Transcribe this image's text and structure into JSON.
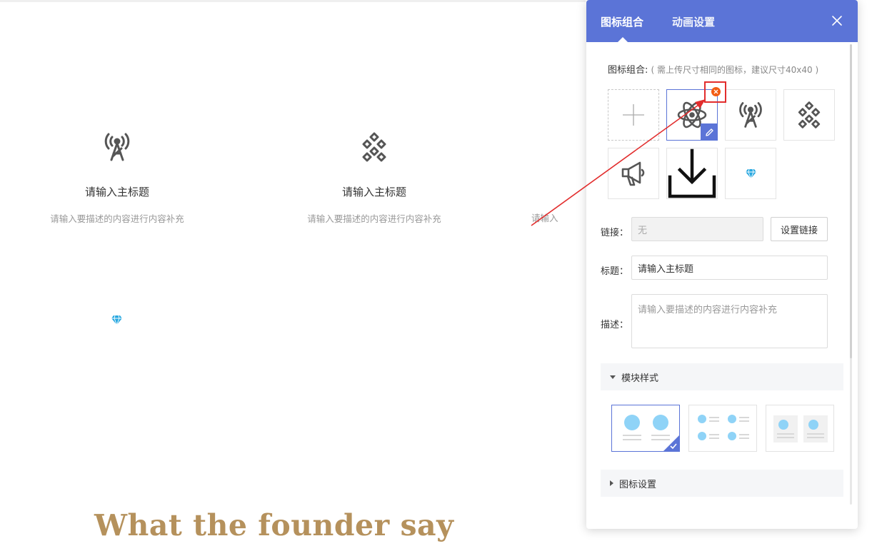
{
  "preview": {
    "features": [
      {
        "title": "请输入主标题",
        "desc": "请输入要描述的内容进行内容补充"
      },
      {
        "title": "请输入主标题",
        "desc": "请输入要描述的内容进行内容补充"
      },
      {
        "desc": "请输入"
      }
    ],
    "founder_heading": "What the founder say"
  },
  "panel": {
    "tabs": [
      {
        "label": "图标组合",
        "active": true
      },
      {
        "label": "动画设置",
        "active": false
      }
    ],
    "close_icon": "close-icon",
    "icon_group": {
      "label": "图标组合:",
      "hint": "( 需上传尺寸相同的图标，建议尺寸40x40 )",
      "icons": [
        "add-icon",
        "atom-icon",
        "radio-tower-icon",
        "diamond-grid-icon",
        "megaphone-icon",
        "download-icon",
        "gem-icon"
      ]
    },
    "link": {
      "label": "链接：",
      "value": "无",
      "button": "设置链接"
    },
    "title_field": {
      "label": "标题：",
      "value": "请输入主标题"
    },
    "desc_field": {
      "label": "描述：",
      "placeholder": "请输入要描述的内容进行内容补充"
    },
    "sections": {
      "module_style": "模块样式",
      "icon_settings": "图标设置"
    }
  },
  "colors": {
    "accent": "#5b74d7",
    "founder": "#b5915c",
    "remove": "#f25c15",
    "annotation": "#e22d2d",
    "style_dot": "#8fd3f7"
  }
}
